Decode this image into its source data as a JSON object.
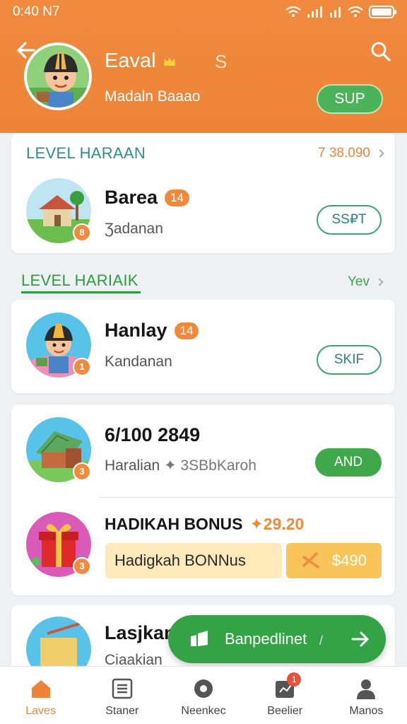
{
  "status_bar": {
    "time": "0:40 N7"
  },
  "header": {
    "name": "Eaval",
    "extra": "S",
    "subtitle": "Madaln Baaao",
    "button_label": "SUP"
  },
  "section1": {
    "title": "LEVEL HARAAN",
    "link": "7 38.090",
    "item": {
      "title": "Barea",
      "chip": "14",
      "badge": "8",
      "subtitle": "Ʒadanan",
      "button_label": "SS₽T"
    }
  },
  "section2": {
    "title": "LEVEL HARIAIK",
    "link": "Yev",
    "item": {
      "title": "Hanlay",
      "chip": "14",
      "badge": "1",
      "subtitle": "Kandanan",
      "button_label": "SKIF"
    }
  },
  "card3": {
    "row1": {
      "title": "6/100 2849",
      "badge": "3",
      "subtitle": "Haralian",
      "subtitle_extra": "✦ 3SBbKaroh",
      "button_label": "AND"
    },
    "row2": {
      "title": "HADIKAH BONUS",
      "amount": "29.20",
      "badge": "3",
      "box_label": "Hadigkah  BONNus",
      "button_amount": "$490"
    }
  },
  "card4": {
    "title": "Lasjkan",
    "subtitle": "Ciaakian"
  },
  "fab": {
    "label": "Banpedlinet",
    "slash": "/"
  },
  "bottom_nav": [
    {
      "label": "Laves",
      "icon": "house-icon",
      "active": true
    },
    {
      "label": "Staner",
      "icon": "list-icon",
      "active": false
    },
    {
      "label": "Neenkec",
      "icon": "camera-icon",
      "active": false
    },
    {
      "label": "Beelier",
      "icon": "gift-icon",
      "active": false,
      "badge": "1"
    },
    {
      "label": "Manos",
      "icon": "person-icon",
      "active": false
    }
  ],
  "colors": {
    "accent": "#ee8438",
    "green": "#3fa84b",
    "chip": "#f0893a"
  }
}
